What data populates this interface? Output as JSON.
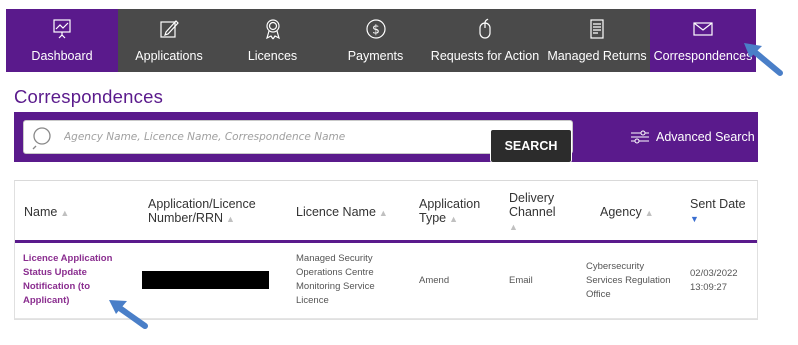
{
  "nav": {
    "items": [
      {
        "label": "Dashboard",
        "icon": "presentation-icon",
        "active": true
      },
      {
        "label": "Applications",
        "icon": "edit-icon",
        "active": false
      },
      {
        "label": "Licences",
        "icon": "award-icon",
        "active": false
      },
      {
        "label": "Payments",
        "icon": "dollar-icon",
        "active": false
      },
      {
        "label": "Requests for Action",
        "icon": "mouse-icon",
        "active": false
      },
      {
        "label": "Managed Returns",
        "icon": "document-icon",
        "active": false
      },
      {
        "label": "Correspondences",
        "icon": "envelope-icon",
        "active": true
      }
    ]
  },
  "page": {
    "title": "Correspondences"
  },
  "search": {
    "placeholder": "Agency Name, Licence Name, Correspondence Name",
    "button_label": "SEARCH",
    "advanced_label": "Advanced Search"
  },
  "table": {
    "headers": {
      "name": "Name",
      "app_number_1": "Application/Licence",
      "app_number_2": "Number/RRN",
      "licence_name": "Licence Name",
      "app_type_1": "Application",
      "app_type_2": "Type",
      "delivery_1": "Delivery",
      "delivery_2": "Channel",
      "agency": "Agency",
      "sent_date": "Sent Date"
    },
    "rows": [
      {
        "name": [
          "Licence Application",
          "Status Update",
          "Notification (to",
          "Applicant)"
        ],
        "licence_name": [
          "Managed Security",
          "Operations Centre",
          "Monitoring Service",
          "Licence"
        ],
        "app_type": "Amend",
        "delivery": "Email",
        "agency": [
          "Cybersecurity",
          "Services Regulation",
          "Office"
        ],
        "sent_date": [
          "02/03/2022",
          "13:09:27"
        ]
      }
    ]
  },
  "colors": {
    "brand_purple": "#5a1a8c",
    "nav_gray": "#4a4a4a",
    "link_purple": "#8a2d8f",
    "arrow_blue": "#4a7fc8"
  }
}
